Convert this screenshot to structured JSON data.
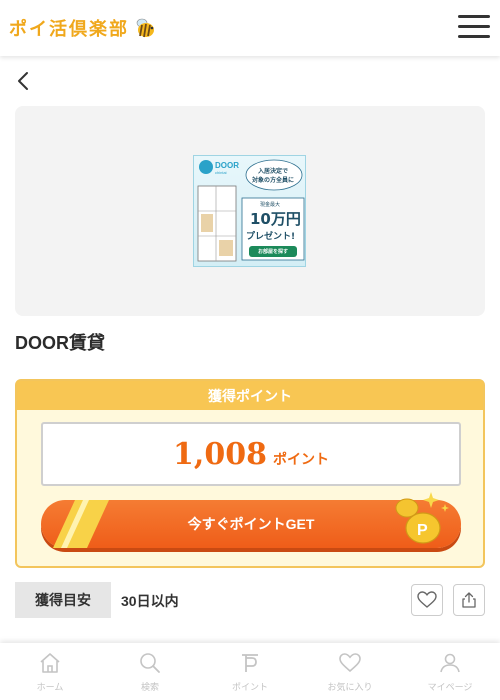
{
  "header": {
    "logo_text": "ポイ活倶楽部",
    "logo_bee_icon": "bee-icon",
    "menu_icon": "hamburger-menu-icon"
  },
  "navigation": {
    "back_icon": "chevron-left-icon"
  },
  "offer": {
    "title": "DOOR賃貸",
    "banner": {
      "brand": "DOOR",
      "brand_sub": "chintai",
      "lines": [
        "入居決定で",
        "対象の方全員に"
      ],
      "note": "現金最大",
      "amount": "10万円",
      "present": "プレゼント!",
      "cta": "お部屋を探す"
    },
    "point_header": "獲得ポイント",
    "points": "1,008",
    "points_unit": "ポイント",
    "get_button": "今すぐポイントGET",
    "meta_label": "獲得目安",
    "meta_value": "30日以内"
  },
  "bottom_nav": {
    "items": [
      {
        "label": "ホーム",
        "icon": "home-icon"
      },
      {
        "label": "検索",
        "icon": "search-icon"
      },
      {
        "label": "ポイント",
        "icon": "point-icon"
      },
      {
        "label": "お気に入り",
        "icon": "heart-icon"
      },
      {
        "label": "マイページ",
        "icon": "user-icon"
      }
    ]
  },
  "colors": {
    "accent_orange": "#ef5d19",
    "point_yellow": "#f8c653",
    "logo_yellow": "#f0a81c"
  }
}
